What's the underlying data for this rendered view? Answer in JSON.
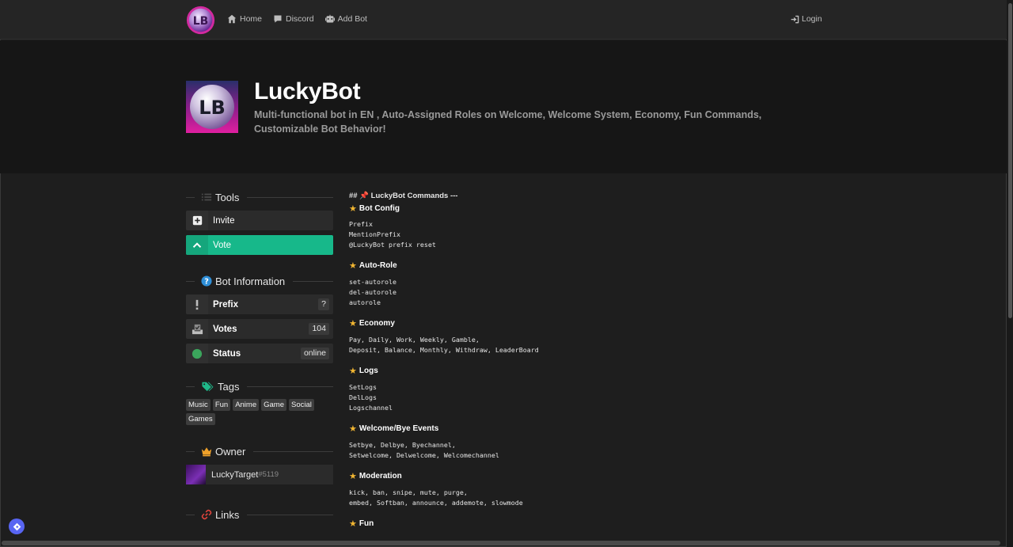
{
  "nav": {
    "logo_text": "LB",
    "links": [
      "Home",
      "Discord",
      "Add Bot"
    ],
    "login": "Login"
  },
  "hero": {
    "avatar_text": "LB",
    "title": "LuckyBot",
    "description": "Multi-functional bot in EN , Auto-Assigned Roles on Welcome, Welcome System, Economy, Fun Commands, Customizable Bot Behavior!"
  },
  "sidebar": {
    "tools_heading": "Tools",
    "invite": "Invite",
    "vote": "Vote",
    "info_heading": "Bot Information",
    "prefix_label": "Prefix",
    "prefix_value": "?",
    "votes_label": "Votes",
    "votes_value": "104",
    "status_label": "Status",
    "status_value": "online",
    "tags_heading": "Tags",
    "tags": [
      "Music",
      "Fun",
      "Anime",
      "Game",
      "Social",
      "Games"
    ],
    "owner_heading": "Owner",
    "owner_name": "LuckyTarget",
    "owner_discriminator": "#5119",
    "links_heading": "Links"
  },
  "main": {
    "header_line": "## 📌 LuckyBot Commands ---",
    "sections": [
      {
        "title": "Bot Config",
        "lines": "Prefix\nMentionPrefix\n@LuckyBot prefix reset"
      },
      {
        "title": "Auto-Role",
        "lines": "set-autorole\ndel-autorole\nautorole"
      },
      {
        "title": "Economy",
        "lines": "Pay, Daily, Work, Weekly, Gamble,\nDeposit, Balance, Monthly, Withdraw, LeaderBoard"
      },
      {
        "title": "Logs",
        "lines": "SetLogs\nDelLogs\nLogschannel"
      },
      {
        "title": "Welcome/Bye Events",
        "lines": "Setbye, Delbye, Byechannel,\nSetwelcome, Delwelcome, Welcomechannel"
      },
      {
        "title": "Moderation",
        "lines": "kick, ban, snipe, mute, purge,\nembed, Softban, announce, addemote, slowmode"
      },
      {
        "title": "Fun",
        "lines": ""
      }
    ]
  },
  "colors": {
    "accent_vote": "#17b88a",
    "status_online": "#3ba55c",
    "star": "#f2b632"
  }
}
